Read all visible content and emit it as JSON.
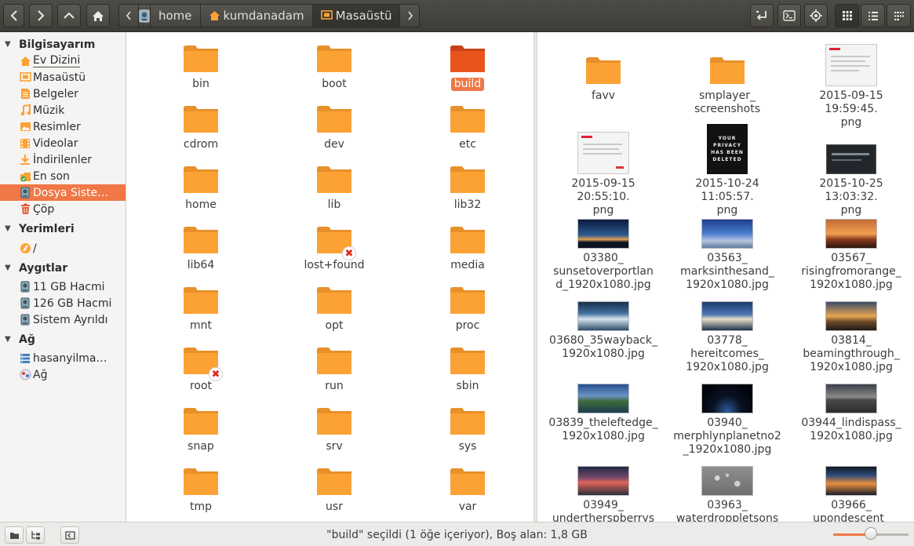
{
  "toolbar": {
    "breadcrumb": [
      {
        "label": "",
        "icon": "drive-icon"
      },
      {
        "label": "home",
        "icon": ""
      },
      {
        "label": "kumdanadam",
        "icon": "home-folder-icon"
      },
      {
        "label": "Masaüstü",
        "icon": "desktop-icon"
      }
    ]
  },
  "sidebar": {
    "sections": [
      {
        "title": "Bilgisayarım",
        "items": [
          {
            "label": "Ev Dizini",
            "icon": "home-icon"
          },
          {
            "label": "Masaüstü",
            "icon": "desktop-icon"
          },
          {
            "label": "Belgeler",
            "icon": "documents-icon"
          },
          {
            "label": "Müzik",
            "icon": "music-icon"
          },
          {
            "label": "Resimler",
            "icon": "pictures-icon"
          },
          {
            "label": "Videolar",
            "icon": "videos-icon"
          },
          {
            "label": "İndirilenler",
            "icon": "downloads-icon"
          },
          {
            "label": "En son",
            "icon": "recent-icon"
          },
          {
            "label": "Dosya Siste…",
            "icon": "filesystem-icon"
          },
          {
            "label": "Çöp",
            "icon": "trash-icon"
          }
        ]
      },
      {
        "title": "Yerimleri",
        "items": [
          {
            "label": "/",
            "icon": "bookmark-root-icon"
          }
        ]
      },
      {
        "title": "Aygıtlar",
        "items": [
          {
            "label": "11 GB Hacmi",
            "icon": "drive-icon"
          },
          {
            "label": "126 GB Hacmi",
            "icon": "drive-icon"
          },
          {
            "label": "Sistem Ayrıldı",
            "icon": "drive-icon"
          }
        ]
      },
      {
        "title": "Ağ",
        "items": [
          {
            "label": "hasanyilma…",
            "icon": "network-host-icon"
          },
          {
            "label": "Ağ",
            "icon": "network-icon"
          }
        ]
      }
    ]
  },
  "left_pane": {
    "items": [
      {
        "label": "bin"
      },
      {
        "label": "boot"
      },
      {
        "label": "build"
      },
      {
        "label": "cdrom"
      },
      {
        "label": "dev"
      },
      {
        "label": "etc"
      },
      {
        "label": "home"
      },
      {
        "label": "lib"
      },
      {
        "label": "lib32"
      },
      {
        "label": "lib64"
      },
      {
        "label": "lost+found"
      },
      {
        "label": "media"
      },
      {
        "label": "mnt"
      },
      {
        "label": "opt"
      },
      {
        "label": "proc"
      },
      {
        "label": "root"
      },
      {
        "label": "run"
      },
      {
        "label": "sbin"
      },
      {
        "label": "snap"
      },
      {
        "label": "srv"
      },
      {
        "label": "sys"
      },
      {
        "label": "tmp"
      },
      {
        "label": "usr"
      },
      {
        "label": "var"
      }
    ]
  },
  "right_pane": {
    "items": [
      {
        "label": "favv"
      },
      {
        "label": "smplayer_\nscreenshots"
      },
      {
        "label": "2015-09-15 19:59:45.\npng"
      },
      {
        "label": "2015-09-15 20:55:10.\npng"
      },
      {
        "label": "2015-10-24 11:05:57.\npng"
      },
      {
        "label": "2015-10-25 13:03:32.\npng"
      },
      {
        "label": "03380_\nsunsetoverportlan\nd_1920x1080.jpg"
      },
      {
        "label": "03563_\nmarksinthesand_\n1920x1080.jpg"
      },
      {
        "label": "03567_\nrisingfromorange_\n1920x1080.jpg"
      },
      {
        "label": "03680_35wayback_\n1920x1080.jpg"
      },
      {
        "label": "03778_\nhereitcomes_\n1920x1080.jpg"
      },
      {
        "label": "03814_\nbeamingthrough_\n1920x1080.jpg"
      },
      {
        "label": "03839_theleftedge_\n1920x1080.jpg"
      },
      {
        "label": "03940_\nmerphlynplanetno2\n_1920x1080.jpg"
      },
      {
        "label": "03944_lindispass_\n1920x1080.jpg"
      },
      {
        "label": "03949_\nundertherspberrys"
      },
      {
        "label": "03963_\nwaterdroppletsons"
      },
      {
        "label": "03966_\nupondescent_"
      }
    ],
    "privacy_text": [
      "YOUR",
      "PRIVACY",
      "HAS BEEN",
      "DELETED"
    ]
  },
  "status": {
    "text": "\"build\" seçildi (1 öğe içeriyor), Boş alan: 1,8 GB",
    "zoom_level": 0.5
  },
  "colors": {
    "accent": "#f07746",
    "folder": "#fca235",
    "folder_selected": "#e9541c"
  }
}
